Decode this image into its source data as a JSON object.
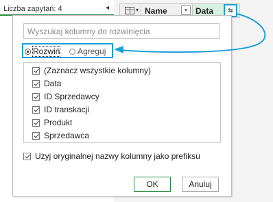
{
  "left_panel": {
    "query_count": "Liczba zapytań: 4",
    "collapse_glyph": "◂"
  },
  "column_header": {
    "grid_menu_icon": "table-icon",
    "name_column": "Name",
    "data_column": "Data",
    "dropdown_glyph": "▾",
    "expand_glyph": "⇆",
    "data_column_highlight": "#d9efe0"
  },
  "popup": {
    "search_placeholder": "Wyszukaj kolumny do rozwinięcia",
    "search_value": "",
    "modes": [
      {
        "label": "Rozwiń",
        "selected": true
      },
      {
        "label": "Agreguj",
        "selected": false
      }
    ],
    "columns": [
      {
        "label": "(Zaznacz wszystkie kolumny)",
        "checked": true
      },
      {
        "label": "Data",
        "checked": true
      },
      {
        "label": "ID Sprzedawcy",
        "checked": true
      },
      {
        "label": "ID transkacji",
        "checked": true
      },
      {
        "label": "Produkt",
        "checked": true
      },
      {
        "label": "Sprzedawca",
        "checked": true
      }
    ],
    "use_prefix": {
      "label": "Użyj oryginalnej nazwy kolumny jako prefiksu",
      "checked": true
    },
    "ok_label": "OK",
    "cancel_label": "Anuluj"
  },
  "colors": {
    "callout_highlight": "#1aa0d8",
    "accent_green": "#2a8a3e"
  }
}
